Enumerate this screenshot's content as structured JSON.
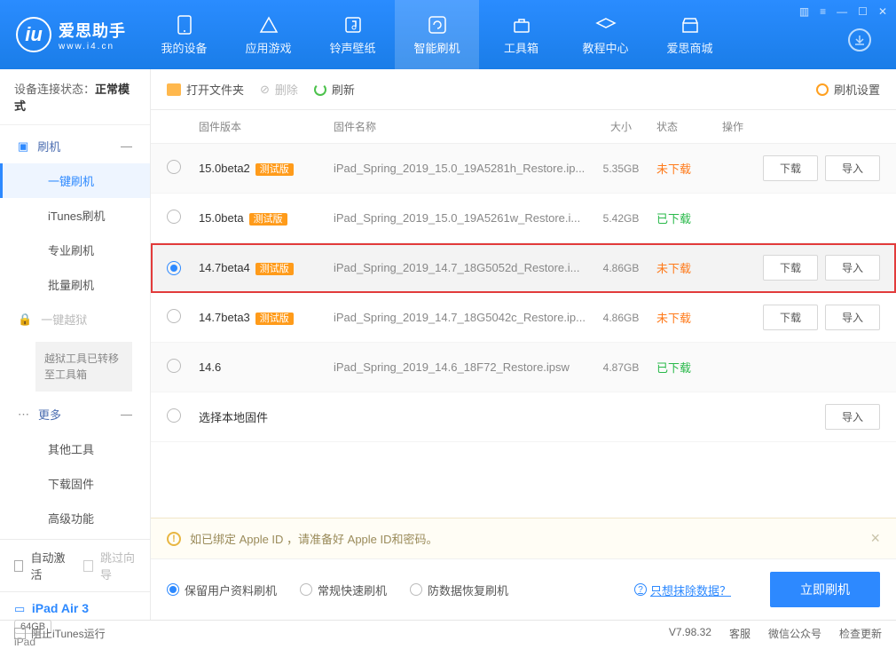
{
  "logo": {
    "title": "爱思助手",
    "sub": "www.i4.cn"
  },
  "nav": {
    "items": [
      {
        "label": "我的设备"
      },
      {
        "label": "应用游戏"
      },
      {
        "label": "铃声壁纸"
      },
      {
        "label": "智能刷机"
      },
      {
        "label": "工具箱"
      },
      {
        "label": "教程中心"
      },
      {
        "label": "爱思商城"
      }
    ]
  },
  "sidebar": {
    "status_label": "设备连接状态：",
    "status_value": "正常模式",
    "section_flash": "刷机",
    "flash_items": [
      {
        "label": "一键刷机"
      },
      {
        "label": "iTunes刷机"
      },
      {
        "label": "专业刷机"
      },
      {
        "label": "批量刷机"
      }
    ],
    "jailbreak_label": "一键越狱",
    "jailbreak_note": "越狱工具已转移至工具箱",
    "section_more": "更多",
    "more_items": [
      {
        "label": "其他工具"
      },
      {
        "label": "下载固件"
      },
      {
        "label": "高级功能"
      }
    ],
    "auto_activate": "自动激活",
    "skip_wizard": "跳过向导",
    "device_name": "iPad Air 3",
    "device_storage": "64GB",
    "device_type": "iPad"
  },
  "toolbar": {
    "open_folder": "打开文件夹",
    "delete": "删除",
    "refresh": "刷新",
    "settings": "刷机设置"
  },
  "table": {
    "headers": {
      "version": "固件版本",
      "name": "固件名称",
      "size": "大小",
      "status": "状态",
      "op": "操作"
    },
    "rows": [
      {
        "version": "15.0beta2",
        "badge": "测试版",
        "name": "iPad_Spring_2019_15.0_19A5281h_Restore.ip...",
        "size": "5.35GB",
        "status": "未下载",
        "status_kind": "warn",
        "download": "下载",
        "import": "导入"
      },
      {
        "version": "15.0beta",
        "badge": "测试版",
        "name": "iPad_Spring_2019_15.0_19A5261w_Restore.i...",
        "size": "5.42GB",
        "status": "已下载",
        "status_kind": "ok"
      },
      {
        "version": "14.7beta4",
        "badge": "测试版",
        "name": "iPad_Spring_2019_14.7_18G5052d_Restore.i...",
        "size": "4.86GB",
        "status": "未下载",
        "status_kind": "warn",
        "download": "下载",
        "import": "导入",
        "selected": true
      },
      {
        "version": "14.7beta3",
        "badge": "测试版",
        "name": "iPad_Spring_2019_14.7_18G5042c_Restore.ip...",
        "size": "4.86GB",
        "status": "未下载",
        "status_kind": "warn",
        "download": "下载",
        "import": "导入"
      },
      {
        "version": "14.6",
        "name": "iPad_Spring_2019_14.6_18F72_Restore.ipsw",
        "size": "4.87GB",
        "status": "已下载",
        "status_kind": "ok"
      },
      {
        "version": "选择本地固件",
        "import": "导入",
        "local": true
      }
    ]
  },
  "notice": "如已绑定 Apple ID ，请准备好 Apple ID和密码。",
  "modes": {
    "options": [
      {
        "label": "保留用户资料刷机",
        "selected": true
      },
      {
        "label": "常规快速刷机"
      },
      {
        "label": "防数据恢复刷机"
      }
    ],
    "erase_link": "只想抹除数据？",
    "flash_btn": "立即刷机"
  },
  "footer": {
    "block_itunes": "阻止iTunes运行",
    "version": "V7.98.32",
    "service": "客服",
    "wechat": "微信公众号",
    "update": "检查更新"
  }
}
